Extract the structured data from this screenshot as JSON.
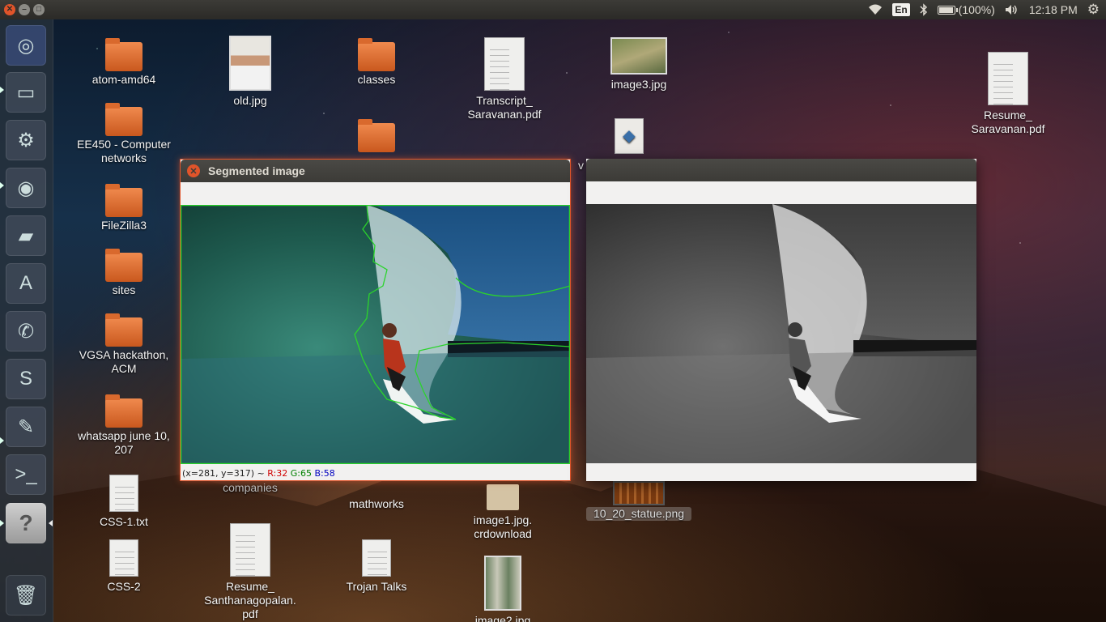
{
  "topbar": {
    "keyboard_layout": "En",
    "battery_text": "(100%)",
    "battery_level": 1.0,
    "clock": "12:18 PM"
  },
  "launcher": {
    "items": [
      {
        "name": "dash-home",
        "icon": "ubuntu-logo-icon"
      },
      {
        "name": "files",
        "icon": "file-cabinet-icon"
      },
      {
        "name": "system-settings",
        "icon": "gear-icon"
      },
      {
        "name": "chromium",
        "icon": "chromium-icon"
      },
      {
        "name": "drive",
        "icon": "drive-icon"
      },
      {
        "name": "software-center",
        "icon": "shopping-bag-icon"
      },
      {
        "name": "xmpp",
        "icon": "chat-icon"
      },
      {
        "name": "skype",
        "icon": "skype-icon"
      },
      {
        "name": "text-editor",
        "icon": "text-editor-icon"
      },
      {
        "name": "terminal",
        "icon": "terminal-icon"
      },
      {
        "name": "help",
        "icon": "question-icon"
      },
      {
        "name": "trash",
        "icon": "trash-icon"
      }
    ]
  },
  "desktop": {
    "icons": [
      {
        "label": "atom-amd64",
        "kind": "folder"
      },
      {
        "label": "EE450 - Computer networks",
        "kind": "folder"
      },
      {
        "label": "FileZilla3",
        "kind": "folder"
      },
      {
        "label": "sites",
        "kind": "folder"
      },
      {
        "label": "VGSA hackathon, ACM",
        "kind": "folder"
      },
      {
        "label": "whatsapp june 10, 207",
        "kind": "folder"
      },
      {
        "label": "CSS-1.txt",
        "kind": "text"
      },
      {
        "label": "CSS-2",
        "kind": "text"
      },
      {
        "label": "old.jpg",
        "kind": "image"
      },
      {
        "label": "companies",
        "kind": "folder"
      },
      {
        "label": "Resume_ Santhanagopalan. pdf",
        "kind": "pdf"
      },
      {
        "label": "classes",
        "kind": "folder"
      },
      {
        "label": "mathworks",
        "kind": "folder"
      },
      {
        "label": "Trojan Talks",
        "kind": "text"
      },
      {
        "label": "Transcript_ Saravanan.pdf",
        "kind": "pdf"
      },
      {
        "label": "image1.jpg. crdownload",
        "kind": "file"
      },
      {
        "label": "image2.jpg",
        "kind": "image"
      },
      {
        "label": "image3.jpg",
        "kind": "image"
      },
      {
        "label": "v",
        "kind": "python"
      },
      {
        "label": "10_20_statue.png",
        "kind": "image"
      },
      {
        "label": "Resume_ Saravanan.pdf",
        "kind": "pdf"
      }
    ]
  },
  "windows": {
    "segmented": {
      "title": "Segmented image",
      "status": {
        "coords": "(x=281, y=317) ~",
        "r": "R:32",
        "g": "G:65",
        "b": "B:58"
      }
    },
    "grayscale": {
      "title": ""
    }
  },
  "colors": {
    "accent_close": "#e0542a",
    "panel": "#3c3b37",
    "contour": "#2bd42b"
  }
}
